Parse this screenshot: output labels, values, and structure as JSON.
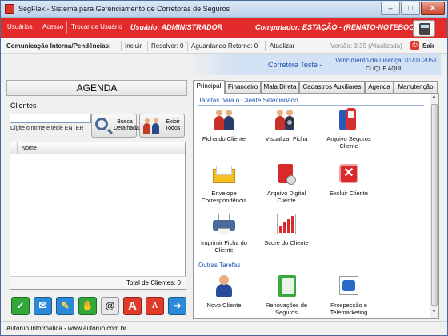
{
  "window": {
    "title": "SegFlex - Sistema para Gerenciamento de Corretoras de Seguros"
  },
  "menu": {
    "items": [
      "Usuários",
      "Acesso",
      "Trocar de Usuário"
    ],
    "user": "Usuário: ADMINISTRADOR",
    "computer": "Computador: ESTAÇÃO - (RENATO-NOTEBOOK)"
  },
  "toolbar": {
    "comunicacao": "Comunicação Interna/Pendências:",
    "incluir": "Incluir",
    "resolver": "Resolver: 0",
    "aguardando": "Aguardando Retorno: 0",
    "atualizar": "Atualizar",
    "versao": "Versão: 3.39 (Atualizada)",
    "sair": "Sair"
  },
  "band": {
    "company": "Corretora Teste -",
    "licenca": "Vencimento da Licença: 01/01/2051",
    "clique": "CLIQUE AQUI"
  },
  "left": {
    "agenda": "AGENDA",
    "clientes": "Clientes",
    "search_value": "",
    "hint": "Digite o nome e tecle ENTER",
    "busca": "Busca Detalhada",
    "exibir": "Exibir Todos",
    "grid_header": "Nome",
    "total": "Total de Clientes: 0",
    "actions": [
      "check",
      "mail",
      "pencil",
      "hand",
      "at",
      "A-red",
      "A-red-small",
      "arrow-right"
    ]
  },
  "tabs": [
    "Principal",
    "Financeiro",
    "Mala Direta",
    "Cadastros Auxiliares",
    "Agenda",
    "Manutenção"
  ],
  "principal": {
    "sec1": "Tarefas para o Cliente Selecionado",
    "sec2": "Outras Tarefas",
    "tiles": [
      {
        "label": "Ficha do Cliente",
        "icon": "people-icon"
      },
      {
        "label": "Visualizar Ficha",
        "icon": "people-search-icon"
      },
      {
        "label": "Arquivo Seguros Cliente",
        "icon": "phones-icon"
      },
      {
        "label": "Envelope Correspondência",
        "icon": "envelope-icon"
      },
      {
        "label": "Arquivo Digital Cliente",
        "icon": "digital-archive-icon"
      },
      {
        "label": "Excluir Cliente",
        "icon": "delete-icon"
      },
      {
        "label": "Imprimir Ficha do Cliente",
        "icon": "printer-icon"
      },
      {
        "label": "Score do Cliente",
        "icon": "bar-chart-icon"
      },
      {
        "label": "Novo Cliente",
        "icon": "new-user-icon"
      },
      {
        "label": "Renovações de Seguros",
        "icon": "notebook-icon"
      },
      {
        "label": "Prospecção e Telemarketing",
        "icon": "telephone-icon"
      }
    ]
  },
  "status": "Autorun Informática - www.autorun.com.br"
}
